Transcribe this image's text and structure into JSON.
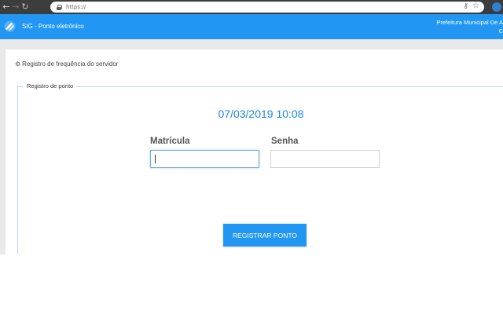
{
  "browser": {
    "back_icon": "arrow-left-icon",
    "forward_icon": "arrow-right-icon",
    "reload_icon": "reload-icon",
    "url": "https://",
    "key_icon": "key-icon",
    "star_icon": "star-icon"
  },
  "header": {
    "title": "SIG - Ponto eletrônico",
    "org_name": "Prefeitura Municipal De A",
    "org_sub": "C",
    "bg_color": "#2196f3"
  },
  "main": {
    "section_heading": "Registro de frequência do servidor",
    "fieldset_legend": "Registro de ponto",
    "datetime": "07/03/2019 10:08",
    "matricula_label": "Matrícula",
    "matricula_value": "",
    "senha_label": "Senha",
    "senha_value": "",
    "register_button": "REGISTRAR PONTO",
    "accent_color": "#1e88e5"
  }
}
